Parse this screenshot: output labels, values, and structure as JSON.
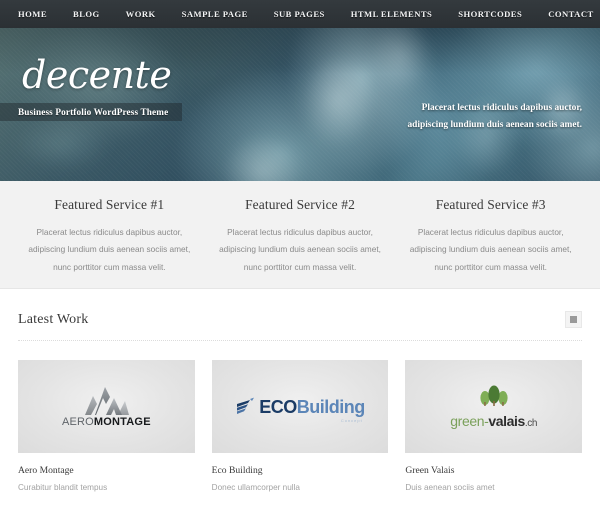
{
  "nav": {
    "items": [
      {
        "label": "HOME"
      },
      {
        "label": "BLOG"
      },
      {
        "label": "WORK"
      },
      {
        "label": "SAMPLE PAGE"
      },
      {
        "label": "SUB PAGES"
      },
      {
        "label": "HTML ELEMENTS"
      },
      {
        "label": "SHORTCODES"
      },
      {
        "label": "CONTACT"
      }
    ]
  },
  "hero": {
    "logo": "decente",
    "tagline": "Business Portfolio WordPress Theme",
    "caption_line1": "Placerat lectus ridiculus dapibus auctor,",
    "caption_line2": "adipiscing lundium duis aenean sociis amet."
  },
  "features": [
    {
      "title": "Featured Service #1",
      "text": "Placerat lectus ridiculus dapibus auctor, adipiscing lundium duis aenean sociis amet, nunc porttitor cum massa velit."
    },
    {
      "title": "Featured Service #2",
      "text": "Placerat lectus ridiculus dapibus auctor, adipiscing lundium duis aenean sociis amet, nunc porttitor cum massa velit."
    },
    {
      "title": "Featured Service #3",
      "text": "Placerat lectus ridiculus dapibus auctor, adipiscing lundium duis aenean sociis amet, nunc porttitor cum massa velit."
    }
  ],
  "work": {
    "heading": "Latest Work",
    "view_toggle_icon": "grid-square-icon",
    "items": [
      {
        "name": "Aero Montage",
        "desc": "Curabitur blandit tempus",
        "logo_icon": "aero-montage-logo",
        "logo_part1": "AERO",
        "logo_part2": "MONTAGE"
      },
      {
        "name": "Eco Building",
        "desc": "Donec ullamcorper nulla",
        "logo_icon": "eco-building-logo",
        "logo_part1": "ECO",
        "logo_part2": "Building",
        "logo_sub": "Concept"
      },
      {
        "name": "Green Valais",
        "desc": "Duis aenean sociis amet",
        "logo_icon": "green-valais-logo",
        "logo_part1": "green-",
        "logo_part2": "valais",
        "logo_part3": ".ch"
      }
    ]
  },
  "colors": {
    "nav_bg": "#2f3337",
    "features_bg": "#f2f2f2",
    "page_bg": "#ffffff",
    "heading": "#3a3a3a",
    "muted_text": "#8a8a8a",
    "thumb_bg": "#e4e4e4"
  }
}
